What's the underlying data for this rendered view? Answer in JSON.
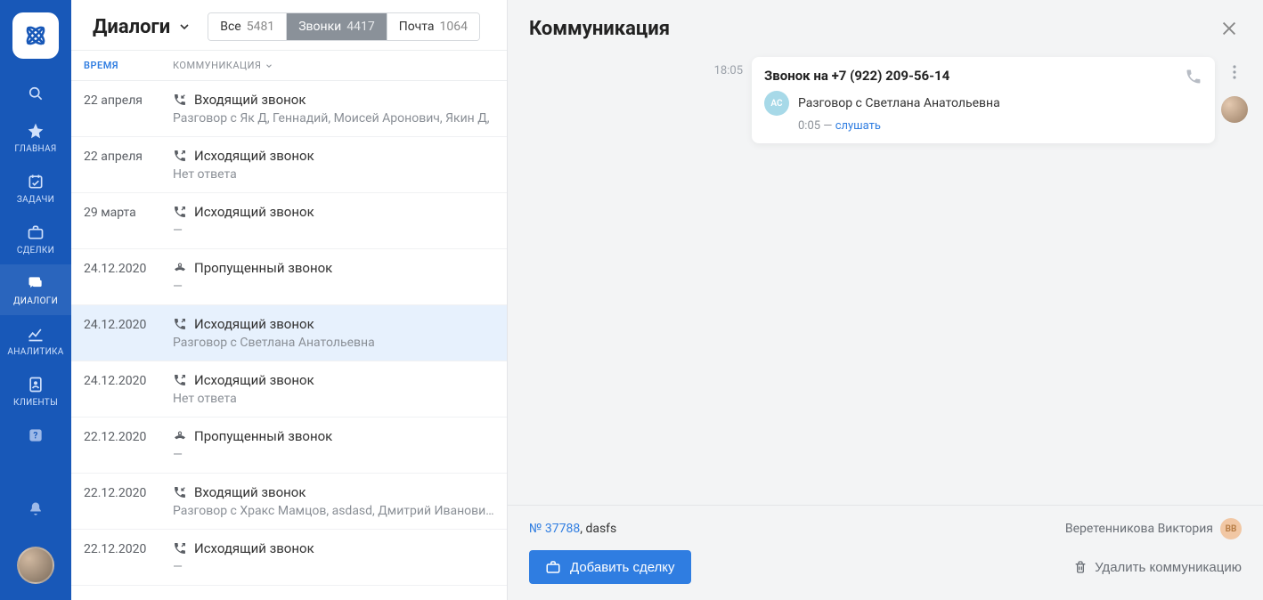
{
  "rail": {
    "items": [
      {
        "label": "ГЛАВНАЯ"
      },
      {
        "label": "ЗАДАЧИ"
      },
      {
        "label": "СДЕЛКИ"
      },
      {
        "label": "ДИАЛОГИ"
      },
      {
        "label": "АНАЛИТИКА"
      },
      {
        "label": "КЛИЕНТЫ"
      }
    ]
  },
  "list": {
    "title": "Диалоги",
    "filters": [
      {
        "label": "Все",
        "count": "5481"
      },
      {
        "label": "Звонки",
        "count": "4417"
      },
      {
        "label": "Почта",
        "count": "1064"
      }
    ],
    "columns": {
      "time": "ВРЕМЯ",
      "communication": "КОММУНИКАЦИЯ"
    },
    "rows": [
      {
        "date": "22 апреля",
        "type_icon": "incoming",
        "type": "Входящий звонок",
        "sub": "Разговор с Як Д, Геннадий, Моисей Аронович, Якин Д,"
      },
      {
        "date": "22 апреля",
        "type_icon": "outgoing",
        "type": "Исходящий звонок",
        "sub": "Нет ответа"
      },
      {
        "date": "29 марта",
        "type_icon": "outgoing",
        "type": "Исходящий звонок",
        "sub": "—"
      },
      {
        "date": "24.12.2020",
        "type_icon": "missed",
        "type": "Пропущенный звонок",
        "sub": "—"
      },
      {
        "date": "24.12.2020",
        "type_icon": "outgoing",
        "type": "Исходящий звонок",
        "sub": "Разговор с Светлана Анатольевна",
        "selected": true
      },
      {
        "date": "24.12.2020",
        "type_icon": "outgoing",
        "type": "Исходящий звонок",
        "sub": "Нет ответа"
      },
      {
        "date": "22.12.2020",
        "type_icon": "missed",
        "type": "Пропущенный звонок",
        "sub": "—"
      },
      {
        "date": "22.12.2020",
        "type_icon": "incoming",
        "type": "Входящий звонок",
        "sub": "Разговор с Хракс Мамцов, asdasd, Дмитрий Иванович,"
      },
      {
        "date": "22.12.2020",
        "type_icon": "outgoing",
        "type": "Исходящий звонок",
        "sub": "—"
      }
    ]
  },
  "detail": {
    "title": "Коммуникация",
    "message": {
      "time": "18:05",
      "title": "Звонок на +7 (922) 209-56-14",
      "contact_initials": "АС",
      "subtitle": "Разговор с Светлана Анатольевна",
      "duration": "0:05",
      "listen_label": "слушать",
      "dash": " — "
    },
    "footer": {
      "deal_prefix": "№ ",
      "deal_number": "37788",
      "deal_suffix": ", dasfs",
      "owner_name": "Веретенникова Виктория",
      "owner_initials": "ВВ",
      "add_deal_label": "Добавить сделку",
      "delete_label": "Удалить коммуникацию"
    }
  }
}
